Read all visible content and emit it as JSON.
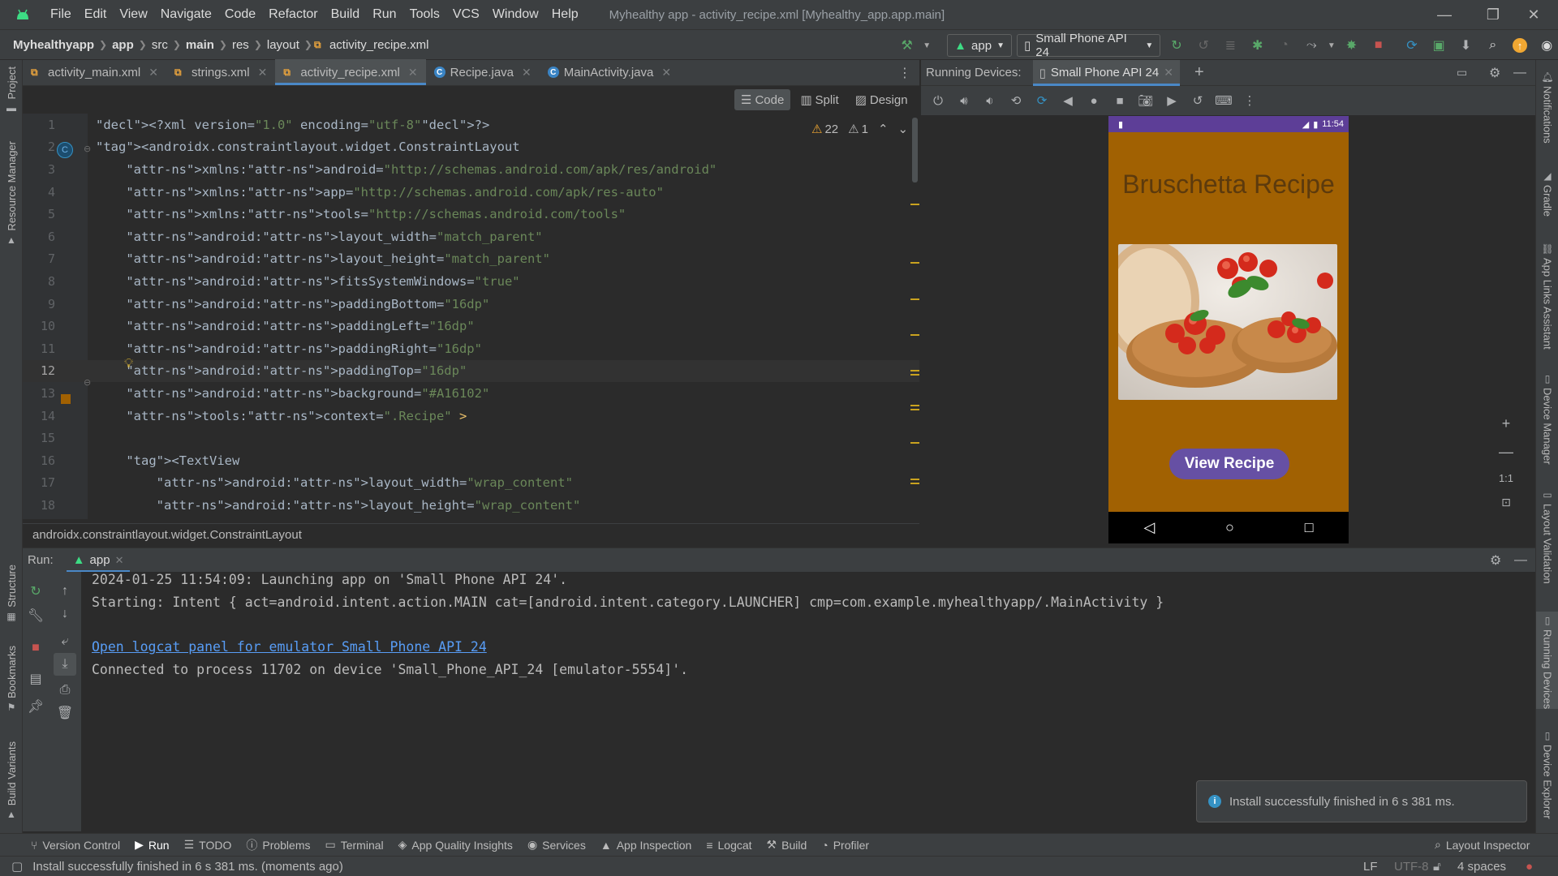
{
  "menubar": {
    "items": [
      "File",
      "Edit",
      "View",
      "Navigate",
      "Code",
      "Refactor",
      "Build",
      "Run",
      "Tools",
      "VCS",
      "Window",
      "Help"
    ],
    "title": "Myhealthy app - activity_recipe.xml [Myhealthy_app.app.main]",
    "minimize": "—",
    "restore": "❐",
    "close": "✕"
  },
  "navbar": {
    "crumbs": [
      "Myhealthyapp",
      "app",
      "src",
      "main",
      "res",
      "layout",
      "activity_recipe.xml"
    ],
    "run_config": "app",
    "device": "Small Phone API 24"
  },
  "left_stripe": [
    "Project",
    "Resource Manager",
    "Structure",
    "Bookmarks",
    "Build Variants"
  ],
  "right_stripe": [
    "Notifications",
    "Gradle",
    "App Links Assistant",
    "Device Manager",
    "Layout Validation",
    "Running Devices",
    "Device Explorer"
  ],
  "editor_tabs": [
    {
      "label": "activity_main.xml",
      "type": "xml"
    },
    {
      "label": "strings.xml",
      "type": "xml"
    },
    {
      "label": "activity_recipe.xml",
      "type": "xml"
    },
    {
      "label": "Recipe.java",
      "type": "java"
    },
    {
      "label": "MainActivity.java",
      "type": "java"
    }
  ],
  "editor_modes": {
    "code": "Code",
    "split": "Split",
    "design": "Design"
  },
  "inspections": {
    "warnings": "22",
    "weak": "1"
  },
  "code_lines": [
    "<?xml version=\"1.0\" encoding=\"utf-8\"?>",
    "<androidx.constraintlayout.widget.ConstraintLayout",
    "    xmlns:android=\"http://schemas.android.com/apk/res/android\"",
    "    xmlns:app=\"http://schemas.android.com/apk/res-auto\"",
    "    xmlns:tools=\"http://schemas.android.com/tools\"",
    "    android:layout_width=\"match_parent\"",
    "    android:layout_height=\"match_parent\"",
    "    android:fitsSystemWindows=\"true\"",
    "    android:paddingBottom=\"16dp\"",
    "    android:paddingLeft=\"16dp\"",
    "    android:paddingRight=\"16dp\"",
    "    android:paddingTop=\"16dp\"",
    "    android:background=\"#A16102\"",
    "    tools:context=\".Recipe\" >",
    "",
    "    <TextView",
    "        android:layout_width=\"wrap_content\"",
    "        android:layout_height=\"wrap_content\""
  ],
  "editor_breadcrumb": "androidx.constraintlayout.widget.ConstraintLayout",
  "running_devices": {
    "label": "Running Devices:",
    "tab": "Small Phone API 24"
  },
  "phone": {
    "time": "11:54",
    "title": "Bruschetta Recipe",
    "button": "View Recipe",
    "bg_color": "#A16102",
    "button_color": "#6650A4"
  },
  "zoom": {
    "plus": "+",
    "minus": "—",
    "one_to_one": "1:1"
  },
  "run_panel": {
    "label": "Run:",
    "tab": "app",
    "lines": [
      "2024-01-25 11:54:09: Launching app on 'Small Phone API 24'.",
      "Starting: Intent { act=android.intent.action.MAIN cat=[android.intent.category.LAUNCHER] cmp=com.example.myhealthyapp/.MainActivity }",
      "",
      "Open logcat panel for emulator Small Phone API 24",
      "Connected to process 11702 on device 'Small_Phone_API_24 [emulator-5554]'."
    ]
  },
  "toast": "Install successfully finished in 6 s 381 ms.",
  "tool_windows": [
    "Version Control",
    "Run",
    "TODO",
    "Problems",
    "Terminal",
    "App Quality Insights",
    "Services",
    "App Inspection",
    "Logcat",
    "Build",
    "Profiler"
  ],
  "layout_inspector": "Layout Inspector",
  "status": {
    "message": "Install successfully finished in 6 s 381 ms. (moments ago)",
    "line_sep": "LF",
    "encoding": "UTF-8",
    "indent": "4 spaces"
  }
}
